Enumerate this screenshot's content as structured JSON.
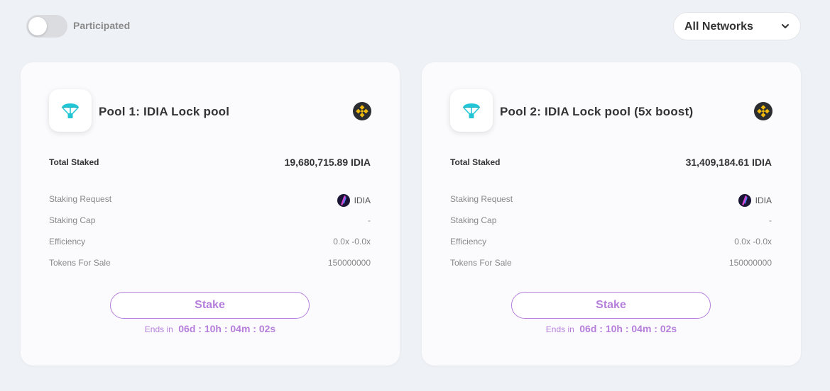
{
  "filter": {
    "participated_label": "Participated",
    "participated_on": false,
    "network_label": "All Networks"
  },
  "colors": {
    "accent": "#b57fdb",
    "background": "#eef1f5",
    "card": "#fbfbfd",
    "pool_icon_fill": "#21c6d6",
    "chain_badge": "#f0b90b"
  },
  "pools": [
    {
      "title": "Pool 1: IDIA Lock pool",
      "pool_icon": "parachute-icon",
      "chain_icon": "binance-icon",
      "total_staked_label": "Total Staked",
      "total_staked_value": "19,680,715.89 IDIA",
      "rows": [
        {
          "label": "Staking Request",
          "value": "IDIA",
          "icon": "idia-token-icon"
        },
        {
          "label": "Staking Cap",
          "value": "-"
        },
        {
          "label": "Efficiency",
          "value": "0.0x -0.0x"
        },
        {
          "label": "Tokens For Sale",
          "value": "150000000"
        }
      ],
      "stake_label": "Stake",
      "ends_label": "Ends in",
      "ends_time": "06d : 10h : 04m : 02s"
    },
    {
      "title": "Pool 2: IDIA Lock pool (5x boost)",
      "pool_icon": "parachute-icon",
      "chain_icon": "binance-icon",
      "total_staked_label": "Total Staked",
      "total_staked_value": "31,409,184.61 IDIA",
      "rows": [
        {
          "label": "Staking Request",
          "value": "IDIA",
          "icon": "idia-token-icon"
        },
        {
          "label": "Staking Cap",
          "value": "-"
        },
        {
          "label": "Efficiency",
          "value": "0.0x -0.0x"
        },
        {
          "label": "Tokens For Sale",
          "value": "150000000"
        }
      ],
      "stake_label": "Stake",
      "ends_label": "Ends in",
      "ends_time": "06d : 10h : 04m : 02s"
    }
  ]
}
